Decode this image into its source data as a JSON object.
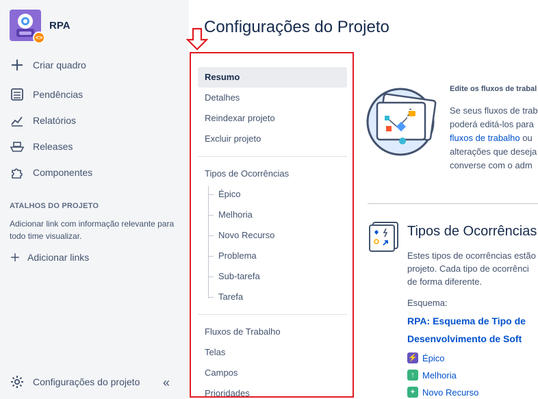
{
  "project": {
    "name": "RPA"
  },
  "sidebar": {
    "items": [
      {
        "label": "Criar quadro",
        "icon": "plus-icon"
      },
      {
        "label": "Pendências",
        "icon": "backlog-icon"
      },
      {
        "label": "Relatórios",
        "icon": "reports-icon"
      },
      {
        "label": "Releases",
        "icon": "ship-icon"
      },
      {
        "label": "Componentes",
        "icon": "puzzle-icon"
      }
    ],
    "shortcuts_title": "ATALHOS DO PROJETO",
    "shortcuts_desc": "Adicionar link com informação relevante para todo time visualizar.",
    "add_links": "Adicionar links",
    "settings": "Configurações do projeto",
    "collapse": "«"
  },
  "page": {
    "title": "Configurações do Projeto"
  },
  "settings_nav": {
    "group1": [
      "Resumo",
      "Detalhes",
      "Reindexar projeto",
      "Excluir projeto"
    ],
    "issue_types": "Tipos de Ocorrências",
    "issue_type_items": [
      "Épico",
      "Melhoria",
      "Novo Recurso",
      "Problema",
      "Sub-tarefa",
      "Tarefa"
    ],
    "group3": [
      "Fluxos de Trabalho",
      "Telas",
      "Campos",
      "Prioridades"
    ]
  },
  "workflows_card": {
    "title": "Edite os fluxos de trabal",
    "line1": "Se seus fluxos de trab",
    "line2": "poderá editá-los para",
    "line3_link": "fluxos de trabalho",
    "line3_rest": " ou",
    "line4": "alterações que deseja",
    "line5": "converse com o adm"
  },
  "issue_types_card": {
    "title": "Tipos de Ocorrências",
    "text1": "Estes tipos de ocorrências estão",
    "text2": "projeto. Cada tipo de ocorrênci",
    "text3": "de forma diferente.",
    "scheme_label": "Esquema:",
    "scheme_line1": "RPA: Esquema de Tipo de",
    "scheme_line2": "Desenvolvimento de Soft",
    "types": [
      {
        "label": "Épico",
        "color": "#6554c0",
        "icon": "epic-icon"
      },
      {
        "label": "Melhoria",
        "color": "#36b37e",
        "icon": "improvement-icon"
      },
      {
        "label": "Novo Recurso",
        "color": "#36b37e",
        "icon": "new-feature-icon"
      }
    ]
  },
  "colors": {
    "highlight": "#e11a22",
    "link": "#0052cc",
    "sidebar_bg": "#f4f5f7"
  }
}
